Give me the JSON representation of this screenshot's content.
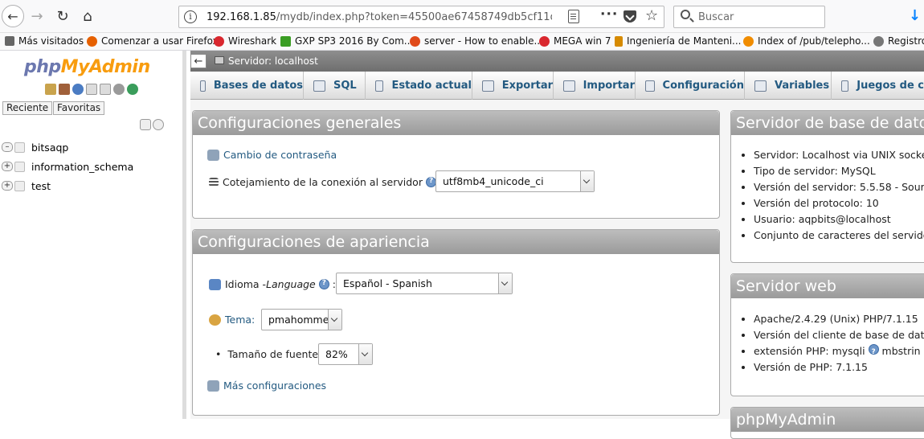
{
  "browser": {
    "url_host": "192.168.1.85",
    "url_path": "/mydb/index.php?token=45500ae67458749db5cf11d",
    "search_placeholder": "Buscar",
    "bookmarks": [
      {
        "label": "Más visitados",
        "icon": "gear-icon",
        "color": "#555555"
      },
      {
        "label": "Comenzar a usar Firefox",
        "icon": "firefox-icon",
        "color": "#e66000"
      },
      {
        "label": "Wireshark",
        "icon": "mega-icon",
        "color": "#d9272e"
      },
      {
        "label": "GXP SP3 2016 By Com...",
        "icon": "download-icon",
        "color": "#3a9d23"
      },
      {
        "label": "server - How to enable...",
        "icon": "ask-icon",
        "color": "#e04a1a"
      },
      {
        "label": "MEGA win 7",
        "icon": "mega-icon",
        "color": "#d9272e"
      },
      {
        "label": "Ingeniería de Manteni...",
        "icon": "wrench-icon",
        "color": "#d68a00"
      },
      {
        "label": "Index of /pub/telepho...",
        "icon": "ftp-icon",
        "color": "#f08c00"
      },
      {
        "label": "Registro",
        "icon": "globe-icon",
        "color": "#666666"
      }
    ]
  },
  "sidebar": {
    "logo_php": "php",
    "logo_myadmin": "MyAdmin",
    "recent_tab": "Reciente",
    "favorites_tab": "Favoritas",
    "databases": [
      "bitsaqp",
      "information_schema",
      "test"
    ]
  },
  "main": {
    "server_bar": "Servidor: localhost",
    "tabs": [
      "Bases de datos",
      "SQL",
      "Estado actual",
      "Exportar",
      "Importar",
      "Configuración",
      "Variables",
      "Juegos de c"
    ],
    "general": {
      "title": "Configuraciones generales",
      "change_password": "Cambio de contraseña",
      "collation_label": "Cotejamiento de la conexión al servidor",
      "collation_value": "utf8mb4_unicode_ci"
    },
    "appearance": {
      "title": "Configuraciones de apariencia",
      "language_label": "Idioma - ",
      "language_label_em": "Language",
      "language_value": "Español - Spanish",
      "theme_label": "Tema:",
      "theme_value": "pmahomme",
      "font_label": "Tamaño de fuente:",
      "font_value": "82%",
      "more_settings": "Más configuraciones"
    },
    "db_server": {
      "title": "Servidor de base de dato",
      "items": [
        "Servidor: Localhost via UNIX socke",
        "Tipo de servidor: MySQL",
        "Versión del servidor: 5.5.58 - Sourc",
        "Versión del protocolo: 10",
        "Usuario: aqpbits@localhost",
        "Conjunto de caracteres del servido"
      ]
    },
    "web_server": {
      "title": "Servidor web",
      "items": [
        "Apache/2.4.29 (Unix) PHP/7.1.15",
        "Versión del cliente de base de dato",
        "extensión PHP: mysqli",
        "Versión de PHP: 7.1.15"
      ],
      "ext_suffix": "mbstrin"
    },
    "phpmyadmin_title": "phpMyAdmin"
  }
}
